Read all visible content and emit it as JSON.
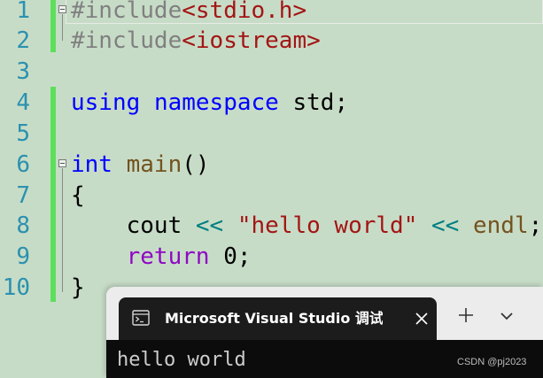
{
  "editor": {
    "line_numbers": [
      "1",
      "2",
      "3",
      "4",
      "5",
      "6",
      "7",
      "8",
      "9",
      "10"
    ],
    "lines": [
      [
        {
          "t": "#include",
          "c": "pp"
        },
        {
          "t": "<stdio.h>",
          "c": "inc"
        }
      ],
      [
        {
          "t": "#include",
          "c": "pp"
        },
        {
          "t": "<iostream>",
          "c": "inc"
        }
      ],
      [],
      [
        {
          "t": "using",
          "c": "kw"
        },
        {
          "t": " ",
          "c": "plain"
        },
        {
          "t": "namespace",
          "c": "kw"
        },
        {
          "t": " std;",
          "c": "plain"
        }
      ],
      [],
      [
        {
          "t": "int",
          "c": "kw"
        },
        {
          "t": " ",
          "c": "plain"
        },
        {
          "t": "main",
          "c": "fn"
        },
        {
          "t": "()",
          "c": "plain"
        }
      ],
      [
        {
          "t": "{",
          "c": "plain"
        }
      ],
      [
        {
          "t": "    cout ",
          "c": "plain"
        },
        {
          "t": "<<",
          "c": "op"
        },
        {
          "t": " ",
          "c": "plain"
        },
        {
          "t": "\"hello world\"",
          "c": "str"
        },
        {
          "t": " ",
          "c": "plain"
        },
        {
          "t": "<<",
          "c": "op"
        },
        {
          "t": " ",
          "c": "plain"
        },
        {
          "t": "endl",
          "c": "fn"
        },
        {
          "t": ";",
          "c": "plain"
        }
      ],
      [
        {
          "t": "    ",
          "c": "plain"
        },
        {
          "t": "return",
          "c": "ctl"
        },
        {
          "t": " 0;",
          "c": "plain"
        }
      ],
      [
        {
          "t": "}",
          "c": "plain"
        }
      ]
    ]
  },
  "terminal": {
    "tab_title": "Microsoft Visual Studio 调试控制台",
    "tab_icon": "console-icon",
    "close_icon": "close-icon",
    "new_tab_icon": "plus-icon",
    "dropdown_icon": "chevron-down-icon",
    "output": "hello world"
  },
  "watermark": "CSDN @pj2023",
  "colors": {
    "editor_background": "#c7dcc7",
    "line_number": "#2b91af",
    "change_bar": "#5ce05c",
    "keyword": "#0000ff",
    "preprocessor": "#808080",
    "string": "#a31515",
    "function": "#74531f",
    "operator": "#008080",
    "control_keyword": "#8f08c4",
    "terminal_tab": "#1c1c1c",
    "terminal_background": "#0c0c0c"
  }
}
